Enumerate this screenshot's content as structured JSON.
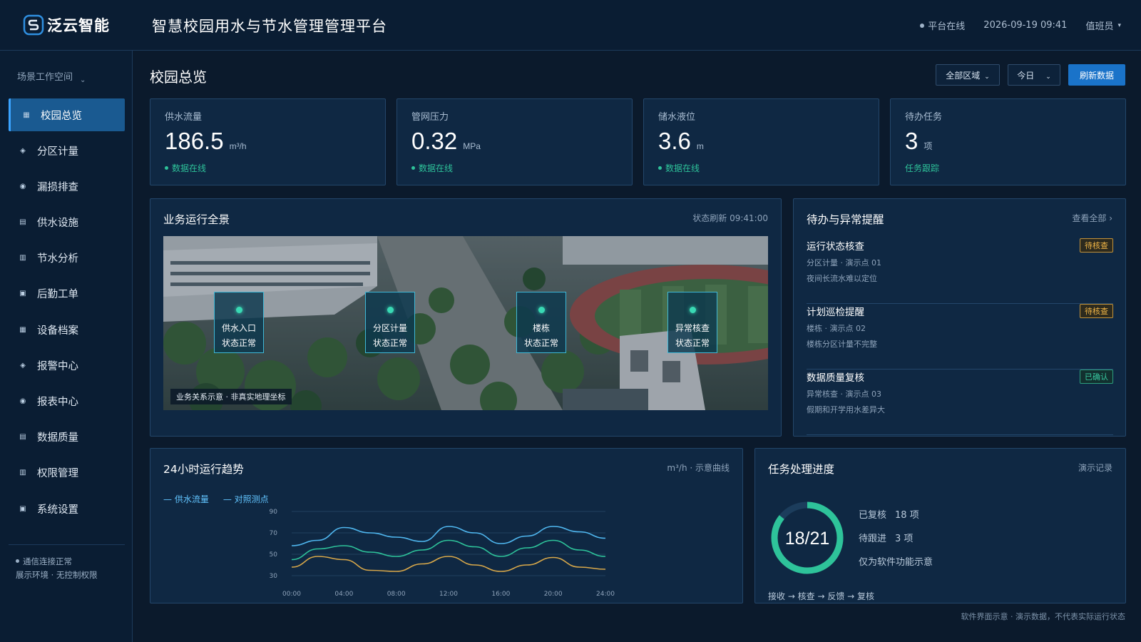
{
  "brand": {
    "name": "泛云智能"
  },
  "header": {
    "title": "智慧校园用水与节水管理管理平台",
    "status": "平台在线",
    "datetime": "2026-09-19 09:41",
    "user": "值班员"
  },
  "sidebar": {
    "workspace": "场景工作空间",
    "items": [
      {
        "label": "校园总览",
        "icon": "grid-icon",
        "active": true
      },
      {
        "label": "分区计量",
        "icon": "diamond-icon"
      },
      {
        "label": "漏损排查",
        "icon": "target-icon"
      },
      {
        "label": "供水设施",
        "icon": "list-icon"
      },
      {
        "label": "节水分析",
        "icon": "bars-icon"
      },
      {
        "label": "后勤工单",
        "icon": "square-icon"
      },
      {
        "label": "设备档案",
        "icon": "grid-icon"
      },
      {
        "label": "报警中心",
        "icon": "diamond-icon"
      },
      {
        "label": "报表中心",
        "icon": "target-icon"
      },
      {
        "label": "数据质量",
        "icon": "list-icon"
      },
      {
        "label": "权限管理",
        "icon": "bars-icon"
      },
      {
        "label": "系统设置",
        "icon": "square-icon"
      }
    ],
    "status_line1": "通信连接正常",
    "status_line2": "展示环境 · 无控制权限"
  },
  "page": {
    "title": "校园总览",
    "filter_area": "全部区域",
    "filter_time": "今日",
    "refresh": "刷新数据"
  },
  "kpis": [
    {
      "label": "供水流量",
      "value": "186.5",
      "unit": "m³/h",
      "status": "数据在线"
    },
    {
      "label": "管网压力",
      "value": "0.32",
      "unit": "MPa",
      "status": "数据在线"
    },
    {
      "label": "储水液位",
      "value": "3.6",
      "unit": "m",
      "status": "数据在线"
    },
    {
      "label": "待办任务",
      "value": "3",
      "unit": "项",
      "status": "任务跟踪"
    }
  ],
  "overview": {
    "title": "业务运行全景",
    "refresh_time": "状态刷新 09:41:00",
    "markers": [
      {
        "name": "供水入口",
        "status": "状态正常"
      },
      {
        "name": "分区计量",
        "status": "状态正常"
      },
      {
        "name": "楼栋",
        "status": "状态正常"
      },
      {
        "name": "异常核查",
        "status": "状态正常"
      }
    ],
    "caption": "业务关系示意 · 非真实地理坐标"
  },
  "alerts": {
    "title": "待办与异常提醒",
    "view_all": "查看全部 ›",
    "items": [
      {
        "title": "运行状态核查",
        "line1": "分区计量 · 演示点 01",
        "line2": "夜间长流水难以定位",
        "badge": "待核查",
        "badge_type": "pending"
      },
      {
        "title": "计划巡检提醒",
        "line1": "楼栋 · 演示点 02",
        "line2": "楼栋分区计量不完整",
        "badge": "待核查",
        "badge_type": "pending"
      },
      {
        "title": "数据质量复核",
        "line1": "异常核查 · 演示点 03",
        "line2": "假期和开学用水差异大",
        "badge": "已确认",
        "badge_type": "done"
      }
    ]
  },
  "trend": {
    "title": "24小时运行趋势",
    "meta": "m³/h · 示意曲线",
    "legend": [
      "— 供水流量",
      "— 对照测点"
    ]
  },
  "chart_data": {
    "type": "line",
    "x": [
      "00:00",
      "02:00",
      "04:00",
      "06:00",
      "08:00",
      "10:00",
      "12:00",
      "14:00",
      "16:00",
      "18:00",
      "20:00",
      "22:00",
      "24:00"
    ],
    "xticks": [
      "00:00",
      "04:00",
      "08:00",
      "12:00",
      "16:00",
      "20:00",
      "24:00"
    ],
    "yticks": [
      90,
      70,
      50,
      30
    ],
    "ylim": [
      30,
      90
    ],
    "series": [
      {
        "name": "供水流量",
        "color": "#4fb6ee",
        "values": [
          58,
          63,
          75,
          70,
          66,
          62,
          76,
          70,
          60,
          67,
          76,
          71,
          65
        ]
      },
      {
        "name": "对照测点",
        "color": "#2ec39a",
        "values": [
          45,
          55,
          58,
          52,
          48,
          54,
          63,
          57,
          48,
          56,
          63,
          54,
          48
        ]
      },
      {
        "name": "",
        "color": "#d8a84a",
        "values": [
          38,
          48,
          45,
          35,
          34,
          41,
          48,
          40,
          34,
          40,
          47,
          38,
          36
        ]
      }
    ]
  },
  "progress": {
    "title": "任务处理进度",
    "meta": "演示记录",
    "done": 18,
    "total": 21,
    "ring_text": "18/21",
    "stat1_label": "已复核",
    "stat1_value": "18 项",
    "stat2_label": "待跟进",
    "stat2_value": "3 项",
    "note": "仅为软件功能示意",
    "flow": "接收 → 核查 → 反馈 → 复核"
  },
  "footer": "软件界面示意 · 演示数据，不代表实际运行状态"
}
